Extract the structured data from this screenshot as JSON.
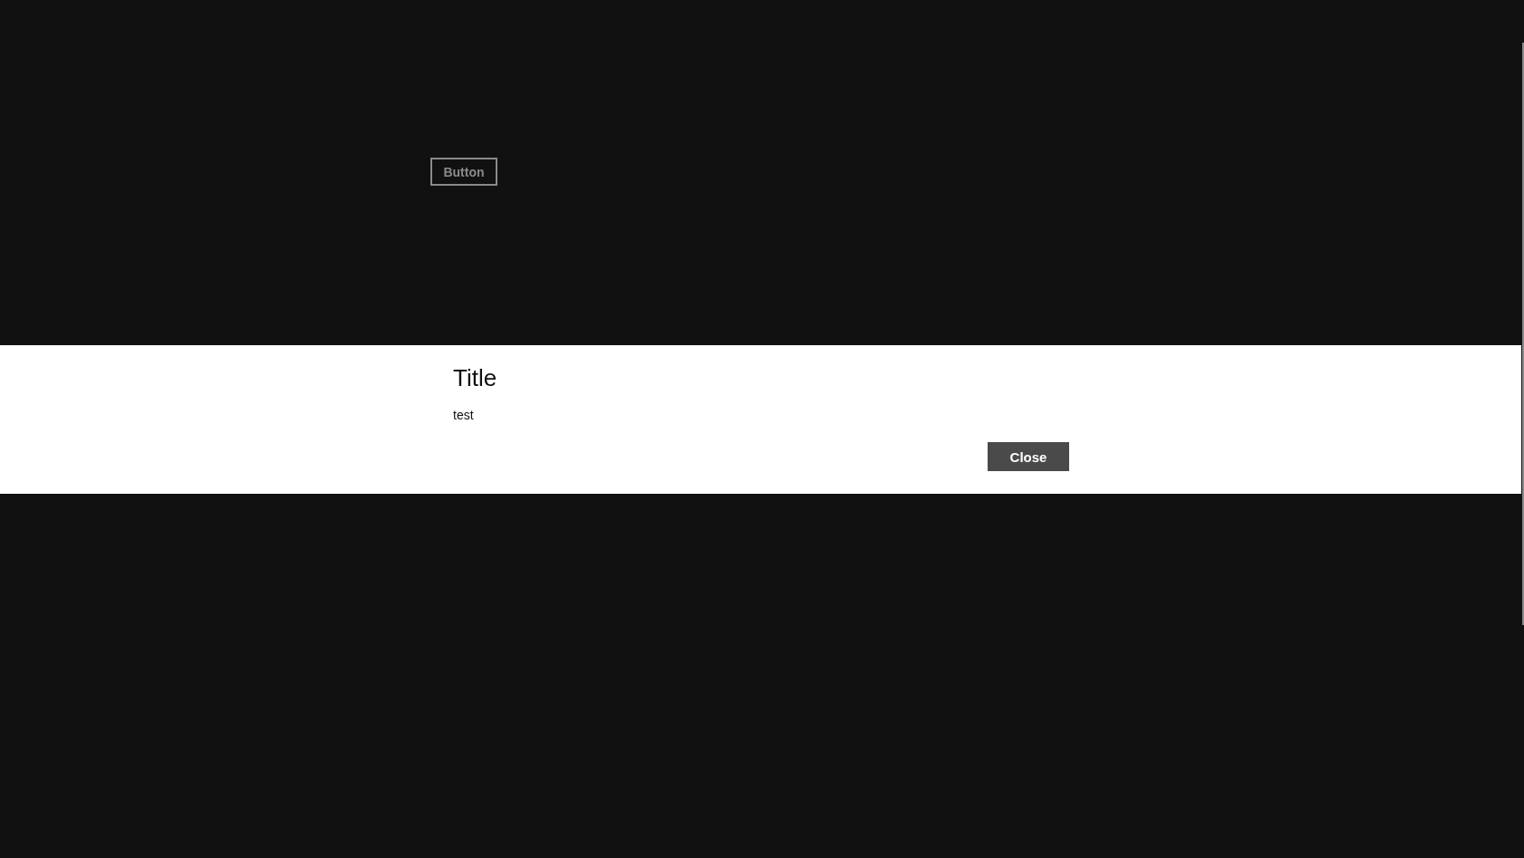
{
  "page": {
    "button": {
      "label": "Button"
    }
  },
  "dialog": {
    "title": "Title",
    "message": "test",
    "buttons": [
      {
        "label": "Close"
      }
    ]
  }
}
